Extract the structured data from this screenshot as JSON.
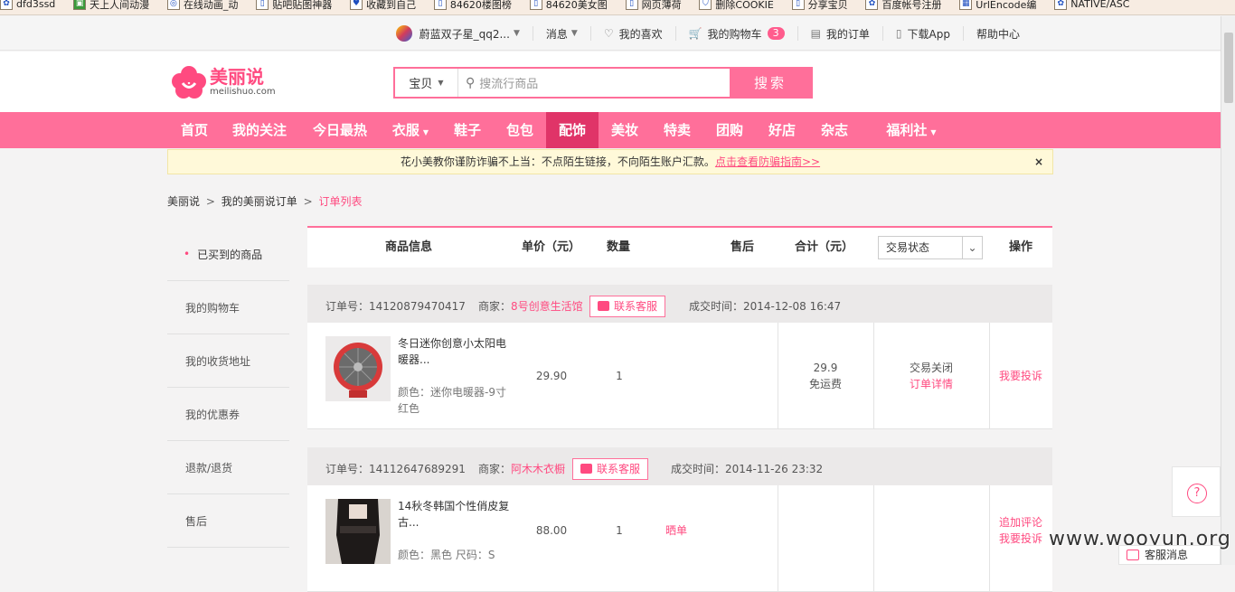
{
  "bookmarks": [
    "dfd3ssd",
    "天上人间动漫",
    "在线动画_动",
    "贴吧贴图神器",
    "收藏到自己",
    "84620楼图榜",
    "84620美女图",
    "网页薄荷",
    "删除COOKIE",
    "分享宝贝",
    "百度帐号注册",
    "UrlEncode编",
    "NATIVE/ASC"
  ],
  "topnav": {
    "username": "蔚蓝双子星_qq2...",
    "messages": "消息",
    "likes": "我的喜欢",
    "cart": "我的购物车",
    "cart_count": "3",
    "orders": "我的订单",
    "download": "下载App",
    "help": "帮助中心"
  },
  "logo": {
    "cn": "美丽说",
    "en": "meilishuo.com"
  },
  "search": {
    "category": "宝贝",
    "placeholder": "搜流行商品",
    "button": "搜索"
  },
  "mainnav": [
    "首页",
    "我的关注",
    "今日最热",
    "衣服",
    "鞋子",
    "包包",
    "配饰",
    "美妆",
    "特卖",
    "团购",
    "好店",
    "杂志",
    "福利社"
  ],
  "mainnav_active": "配饰",
  "notice": {
    "text": "花小美教你谨防诈骗不上当：不点陌生链接，不向陌生账户汇款。",
    "link": "点击查看防骗指南>>",
    "close": "×"
  },
  "breadcrumb": {
    "a": "美丽说",
    "b": "我的美丽说订单",
    "c": "订单列表",
    "sep": ">"
  },
  "sidebar": [
    "已买到的商品",
    "我的购物车",
    "我的收货地址",
    "我的优惠券",
    "退款/退货",
    "售后"
  ],
  "table_header": {
    "info": "商品信息",
    "price": "单价（元）",
    "qty": "数量",
    "after": "售后",
    "total": "合计（元）",
    "status": "交易状态",
    "op": "操作"
  },
  "orders": [
    {
      "no_label": "订单号：",
      "no": "14120879470417",
      "seller_label": "商家：",
      "seller": "8号创意生活馆",
      "contact": "联系客服",
      "time_label": "成交时间：",
      "time": "2014-12-08 16:47",
      "name": "冬日迷你创意小太阳电暖器...",
      "attr": "颜色：迷你电暖器-9寸 红色",
      "price": "29.90",
      "qty": "1",
      "after": "",
      "total": "29.9",
      "shipping": "免运费",
      "status": "交易关闭",
      "detail": "订单详情",
      "op1": "我要投诉",
      "op2": ""
    },
    {
      "no_label": "订单号：",
      "no": "14112647689291",
      "seller_label": "商家：",
      "seller": "阿木木衣橱",
      "contact": "联系客服",
      "time_label": "成交时间：",
      "time": "2014-11-26 23:32",
      "name": "14秋冬韩国个性俏皮复古...",
      "attr": "颜色：黑色 尺码：S",
      "price": "88.00",
      "qty": "1",
      "after": "晒单",
      "total": "",
      "shipping": "",
      "status": "",
      "detail": "",
      "op1": "追加评论",
      "op2": "我要投诉"
    }
  ],
  "help_icon": "?",
  "customer_service": "客服消息",
  "watermark": "www.wooyun.org"
}
